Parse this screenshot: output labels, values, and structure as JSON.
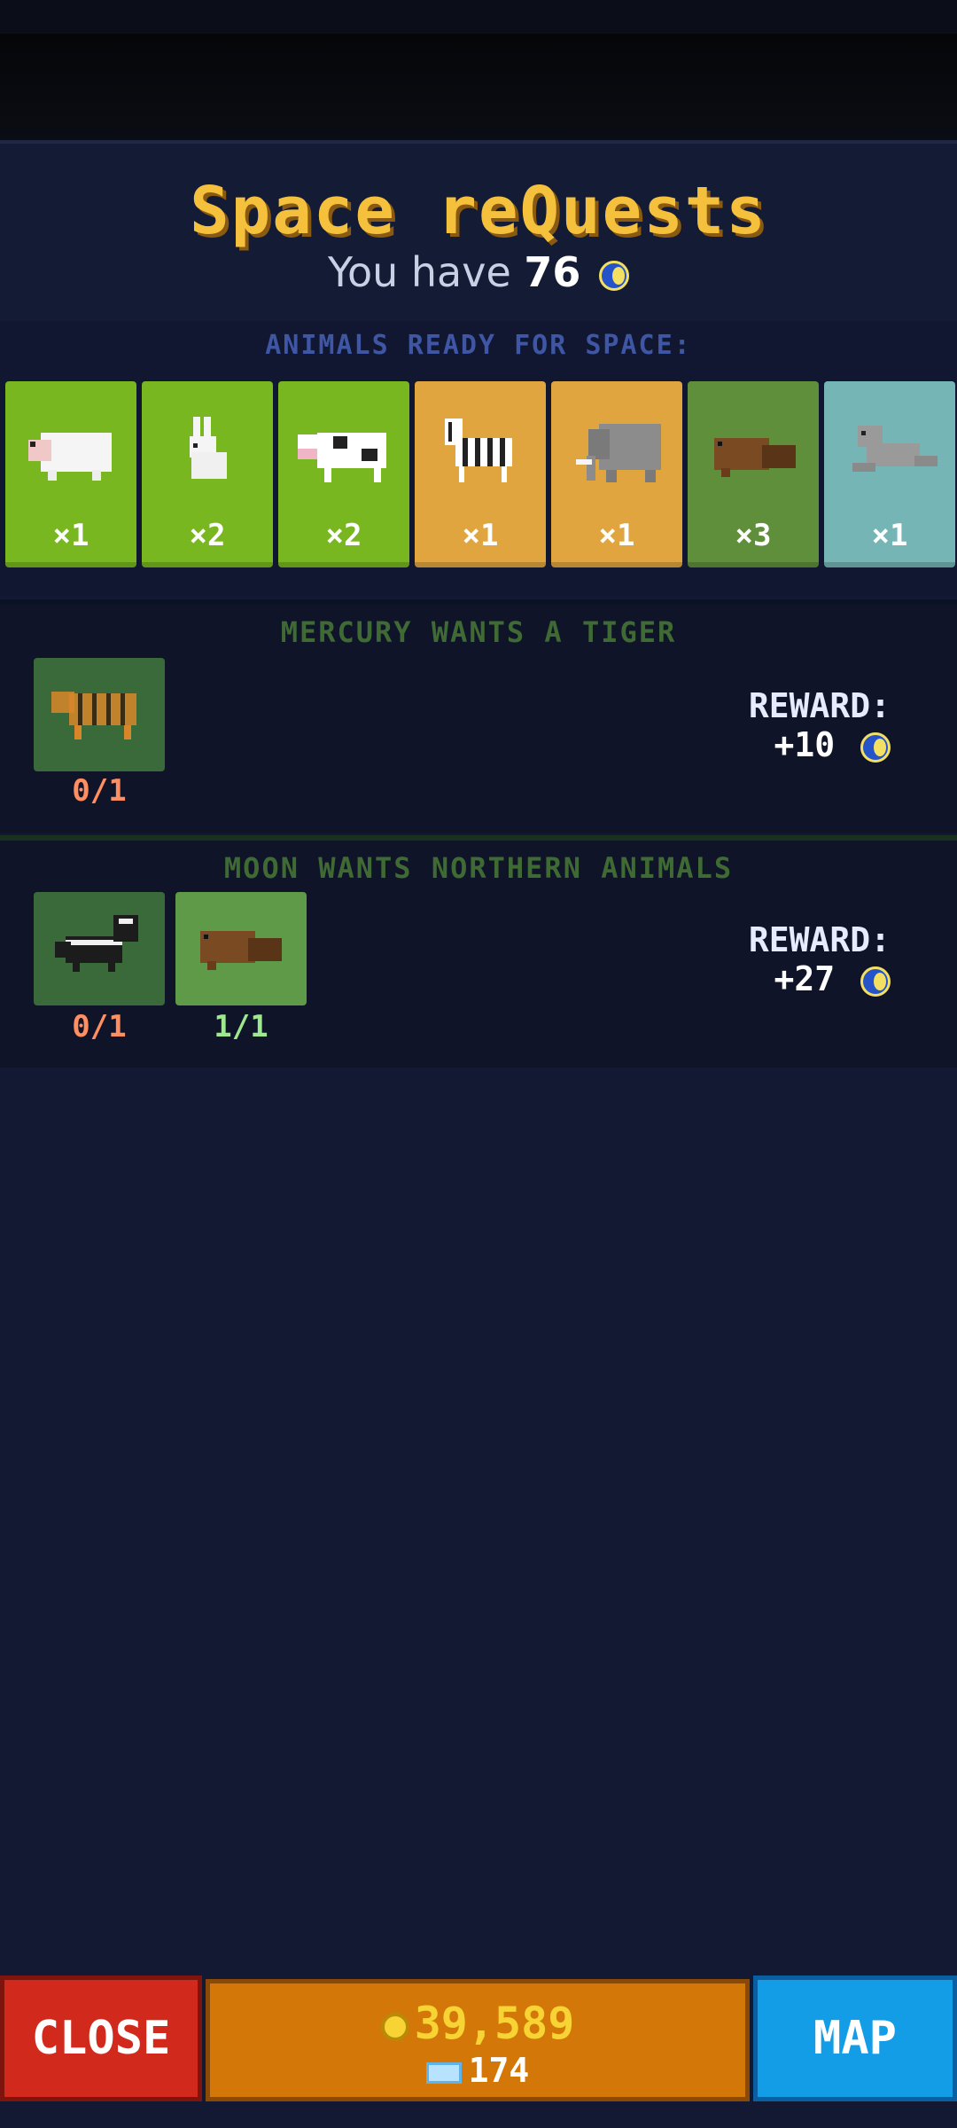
{
  "header": {
    "title": "Space reQuests",
    "have_prefix": "You have",
    "have_amount": "76"
  },
  "ready": {
    "label": "ANIMALS READY FOR SPACE:",
    "cards": [
      {
        "animal": "sheep",
        "count": "×1",
        "color": "#78b71f"
      },
      {
        "animal": "rabbit",
        "count": "×2",
        "color": "#78b71f"
      },
      {
        "animal": "cow",
        "count": "×2",
        "color": "#78b71f"
      },
      {
        "animal": "zebra",
        "count": "×1",
        "color": "#e0a53f"
      },
      {
        "animal": "elephant",
        "count": "×1",
        "color": "#e0a53f"
      },
      {
        "animal": "beaver",
        "count": "×3",
        "color": "#5f8f3a"
      },
      {
        "animal": "seal",
        "count": "×1",
        "color": "#76b5b5"
      }
    ]
  },
  "quests": [
    {
      "title": "MERCURY WANTS A TIGER",
      "items": [
        {
          "animal": "tiger",
          "progress": "0/1"
        }
      ],
      "reward_label": "REWARD:",
      "reward_amount": "+10"
    },
    {
      "title": "MOON WANTS NORTHERN ANIMALS",
      "items": [
        {
          "animal": "skunk",
          "progress": "0/1"
        },
        {
          "animal": "beaver",
          "progress": "1/1"
        }
      ],
      "reward_label": "REWARD:",
      "reward_amount": "+27"
    }
  ],
  "footer": {
    "close_label": "CLOSE",
    "gold": "39,589",
    "tickets": "174",
    "map_label": "MAP"
  },
  "icons": {
    "currency": "moon-coin-icon",
    "gold": "gold-coin-icon",
    "ticket": "ticket-icon"
  }
}
